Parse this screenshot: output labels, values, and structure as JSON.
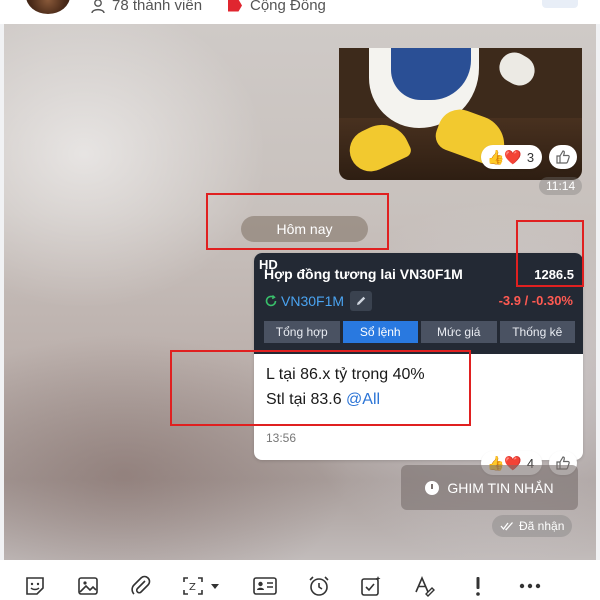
{
  "header": {
    "members_text": "78 thành viên",
    "community_text": "Cộng Đồng"
  },
  "messages": {
    "gif_reactions": {
      "emojis": "👍❤️",
      "count": "3"
    },
    "gif_time": "11:14",
    "date_chip": "Hôm nay",
    "card": {
      "hd_badge": "HD",
      "title": "Hợp đồng tương lai VN30F1M",
      "price": "1286.5",
      "symbol": "VN30F1M",
      "change": "-3.9 / -0.30%",
      "tabs": [
        {
          "label": "Tổng hợp",
          "active": false
        },
        {
          "label": "Sổ lệnh",
          "active": true
        },
        {
          "label": "Mức giá",
          "active": false
        },
        {
          "label": "Thống kê",
          "active": false
        }
      ],
      "line1": "L tại 86.x tỷ trọng 40%",
      "line2_prefix": "Stl tại 83.6 ",
      "line2_mention": "@All",
      "time": "13:56"
    },
    "card_reactions": {
      "emojis": "👍❤️",
      "count": "4"
    },
    "pin_button": "GHIM TIN NHẮN",
    "received_status": "Đã nhận"
  },
  "toolbar": {
    "icons": [
      "sticker-icon",
      "image-icon",
      "attachment-icon",
      "screenshot-icon",
      "contact-card-icon",
      "reminder-icon",
      "task-icon",
      "format-text-icon",
      "urgent-icon",
      "more-icon"
    ]
  },
  "colors": {
    "accent": "#2979e0",
    "negative": "#ff5a52",
    "card_dark": "#232934",
    "annotation_red": "#e02020"
  }
}
